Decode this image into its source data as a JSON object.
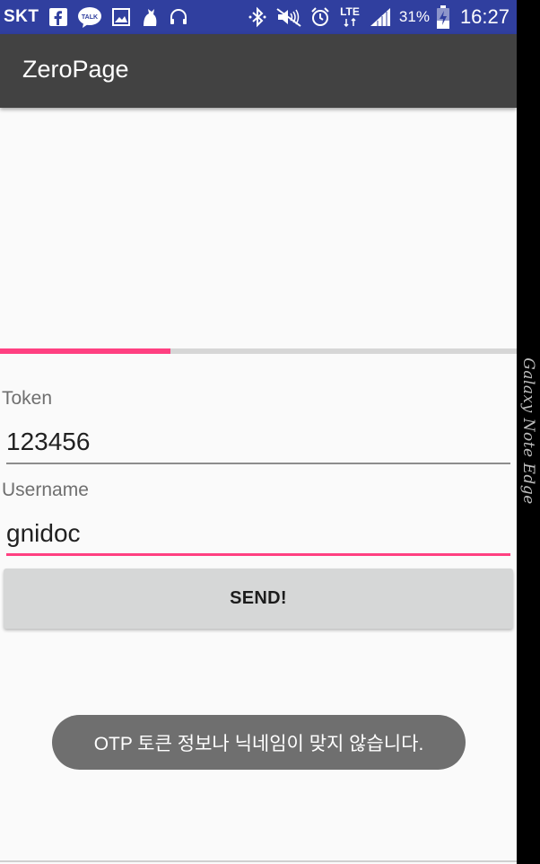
{
  "status_bar": {
    "carrier": "SKT",
    "battery_percent": "31%",
    "time": "16:27",
    "network_type": "LTE",
    "icons": [
      "facebook-icon",
      "kakaotalk-icon",
      "gallery-icon",
      "app-icon",
      "headphones-icon",
      "bluetooth-icon",
      "mute-icon",
      "alarm-icon",
      "lte-icon",
      "signal-icon",
      "battery-charging-icon"
    ],
    "background_color": "#303f9f"
  },
  "toolbar": {
    "title": "ZeroPage",
    "background_color": "#424242"
  },
  "progress": {
    "value_fraction": 0.33,
    "fill_color": "#ff4081",
    "track_color": "#d6d6d6"
  },
  "form": {
    "token_label": "Token",
    "token_value": "123456",
    "username_label": "Username",
    "username_value": "gnidoc",
    "focused_field": "username",
    "accent_color": "#ff4081"
  },
  "send_button": {
    "label": "SEND!"
  },
  "toast": {
    "message": "OTP 토큰 정보나 닉네임이 맞지 않습니다."
  },
  "edge_panel": {
    "label": "Galaxy Note Edge"
  }
}
